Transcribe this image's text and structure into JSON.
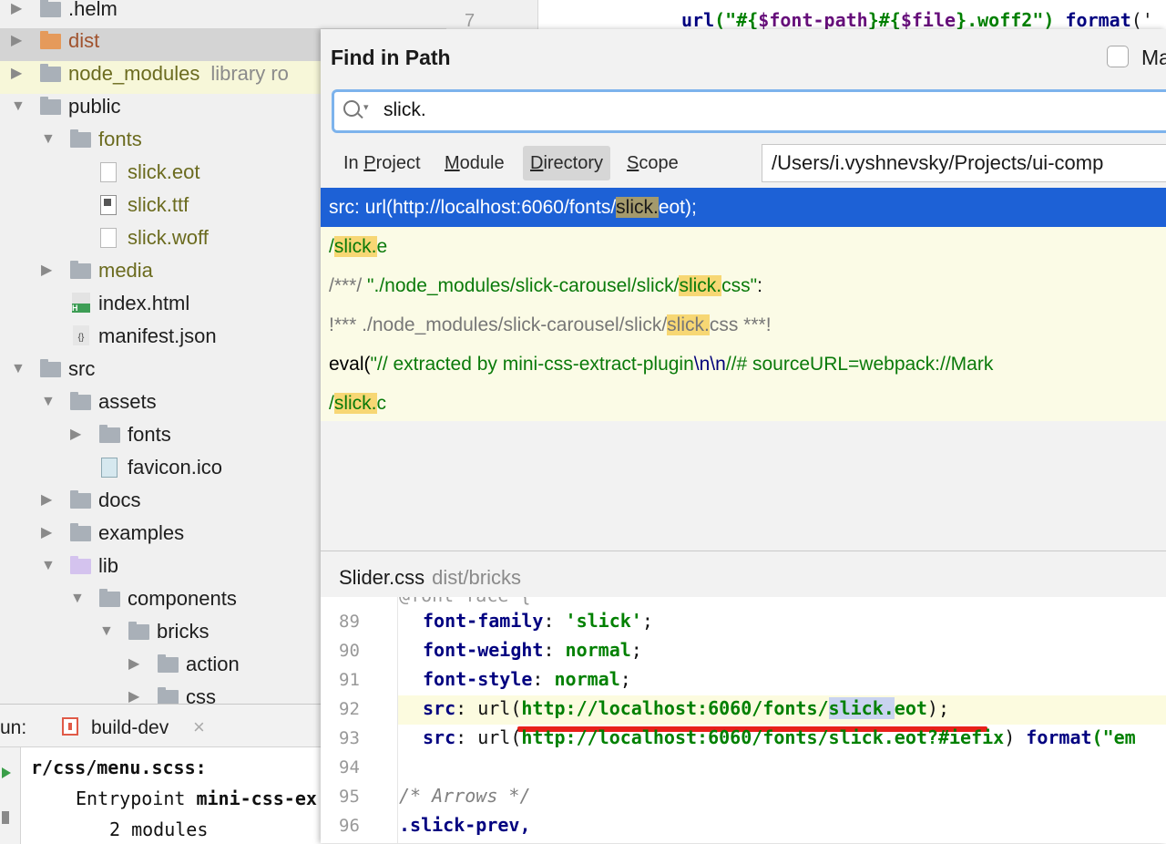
{
  "tree": {
    "items": [
      {
        "label": "",
        "top": 0
      },
      {
        "label": ".helm"
      },
      {
        "label": "dist"
      },
      {
        "label": "node_modules",
        "sub": "library ro"
      },
      {
        "label": "public"
      },
      {
        "label": "fonts"
      },
      {
        "label": "slick.eot"
      },
      {
        "label": "slick.ttf"
      },
      {
        "label": "slick.woff"
      },
      {
        "label": "media"
      },
      {
        "label": "index.html"
      },
      {
        "label": "manifest.json"
      },
      {
        "label": "src"
      },
      {
        "label": "assets"
      },
      {
        "label": "fonts"
      },
      {
        "label": "favicon.ico"
      },
      {
        "label": "docs"
      },
      {
        "label": "examples"
      },
      {
        "label": "lib"
      },
      {
        "label": "components"
      },
      {
        "label": "bricks"
      },
      {
        "label": "action"
      },
      {
        "label": "css"
      }
    ]
  },
  "editor_bg": {
    "line_number": "7",
    "code": {
      "fn": "url",
      "open": "(\"#{",
      "var1": "$font-path",
      "mid": "}#{",
      "var2": "$file",
      "close": "}.woff2\")",
      "fmt": "format",
      "tail": "('"
    }
  },
  "run_panel": {
    "label": "un:",
    "tab_label": "build-dev",
    "close_glyph": "×",
    "lines": [
      "r/css/menu.scss:",
      "Entrypoint",
      "mini-css-ex",
      "2 modules"
    ]
  },
  "dialog": {
    "title": "Find in Path",
    "match_case_label": "Ma",
    "search_value": "slick.",
    "scope_tabs": {
      "in_project": {
        "prefix": "In ",
        "underline": "P",
        "rest": "roject"
      },
      "module": {
        "prefix": "",
        "underline": "M",
        "rest": "odule"
      },
      "directory": {
        "prefix": "",
        "underline": "D",
        "rest": "irectory"
      },
      "scope": {
        "prefix": "",
        "underline": "S",
        "rest": "cope"
      }
    },
    "directory_path": "/Users/i.vyshnevsky/Projects/ui-comp",
    "results": [
      {
        "pre": "src: url(http://localhost:6060/fonts/",
        "hit": "slick.",
        "post": "eot);"
      },
      {
        "pre": "/",
        "hit": "slick.",
        "post": "e"
      },
      {
        "pre": "/***/ ",
        "str_pre": "\"./node_modules/slick-carousel/slick/",
        "hit": "slick.",
        "str_post": "css\"",
        "post": ":"
      },
      {
        "pre": " !*** ./node_modules/slick-carousel/slick/",
        "hit": "slick.",
        "post": "css ***!"
      },
      {
        "pre": "eval(",
        "str": "\"// extracted by mini-css-extract-plugin",
        "esc": "\\n\\n",
        "str2": "//# sourceURL=webpack://Mark"
      },
      {
        "pre": "/",
        "hit": "slick.",
        "post": "c"
      }
    ],
    "preview": {
      "file": "Slider.css",
      "path": "dist/bricks",
      "lines": [
        {
          "num": "89",
          "prop": "font-family",
          "val": "'slick'",
          "end": ";"
        },
        {
          "num": "90",
          "prop": "font-weight",
          "val": "normal",
          "end": ";"
        },
        {
          "num": "91",
          "prop": "font-style",
          "val": "normal",
          "end": ";"
        },
        {
          "num": "92",
          "prop": "src",
          "fn": "url(",
          "url_pre": "http://localhost:6060/fonts/",
          "hit": "slick.",
          "url_post": "eot",
          "end": ");"
        },
        {
          "num": "93",
          "prop": "src",
          "fn": "url(",
          "url": "http://localhost:6060/fonts/slick.eot?#iefix",
          "mid": ") ",
          "fmt": "format",
          "tail": "(\"em"
        },
        {
          "num": "94"
        },
        {
          "num": "95",
          "comment": "/* Arrows */"
        },
        {
          "num": "96",
          "selector": ".slick-prev,"
        }
      ]
    }
  },
  "colors": {
    "selection": "#1d61d6",
    "highlight": "#f7d774",
    "accent_border": "#7db3ec",
    "underline": "#e8201a"
  }
}
